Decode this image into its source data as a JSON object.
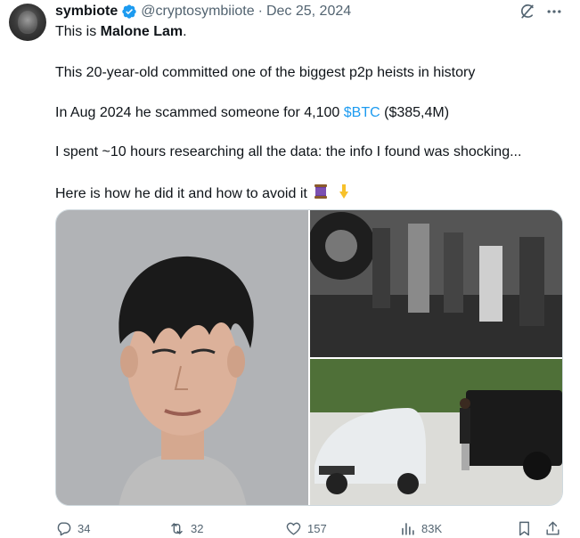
{
  "author": {
    "name": "symbiote",
    "handle": "@cryptosymbiiote",
    "separator": "·",
    "date": "Dec 25, 2024"
  },
  "body": {
    "line1_prefix": "This is ",
    "line1_bold": "Malone Lam",
    "line1_suffix": ".",
    "line2": "This 20-year-old committed one of the biggest p2p heists in history",
    "line3_prefix": "In Aug 2024 he scammed someone for 4,100 ",
    "line3_cashtag": "$BTC",
    "line3_suffix": " ($385,4M)",
    "line4": "I spent ~10 hours researching all the data: the info I found was shocking...",
    "line5": "Here is how he did it and how to avoid it"
  },
  "actions": {
    "replies": "34",
    "reposts": "32",
    "likes": "157",
    "views": "83K"
  },
  "colors": {
    "accent": "#1d9bf0",
    "muted": "#536471",
    "text": "#0f1419",
    "border": "#cfd9de"
  },
  "icons": {
    "verified": "verified-badge-icon",
    "grok": "grok-icon",
    "more": "more-icon",
    "thread": "spool-icon",
    "pointing": "pointing-down-icon",
    "reply": "reply-icon",
    "repost": "repost-icon",
    "like": "heart-icon",
    "views": "views-icon",
    "bookmark": "bookmark-icon",
    "share": "share-icon"
  }
}
